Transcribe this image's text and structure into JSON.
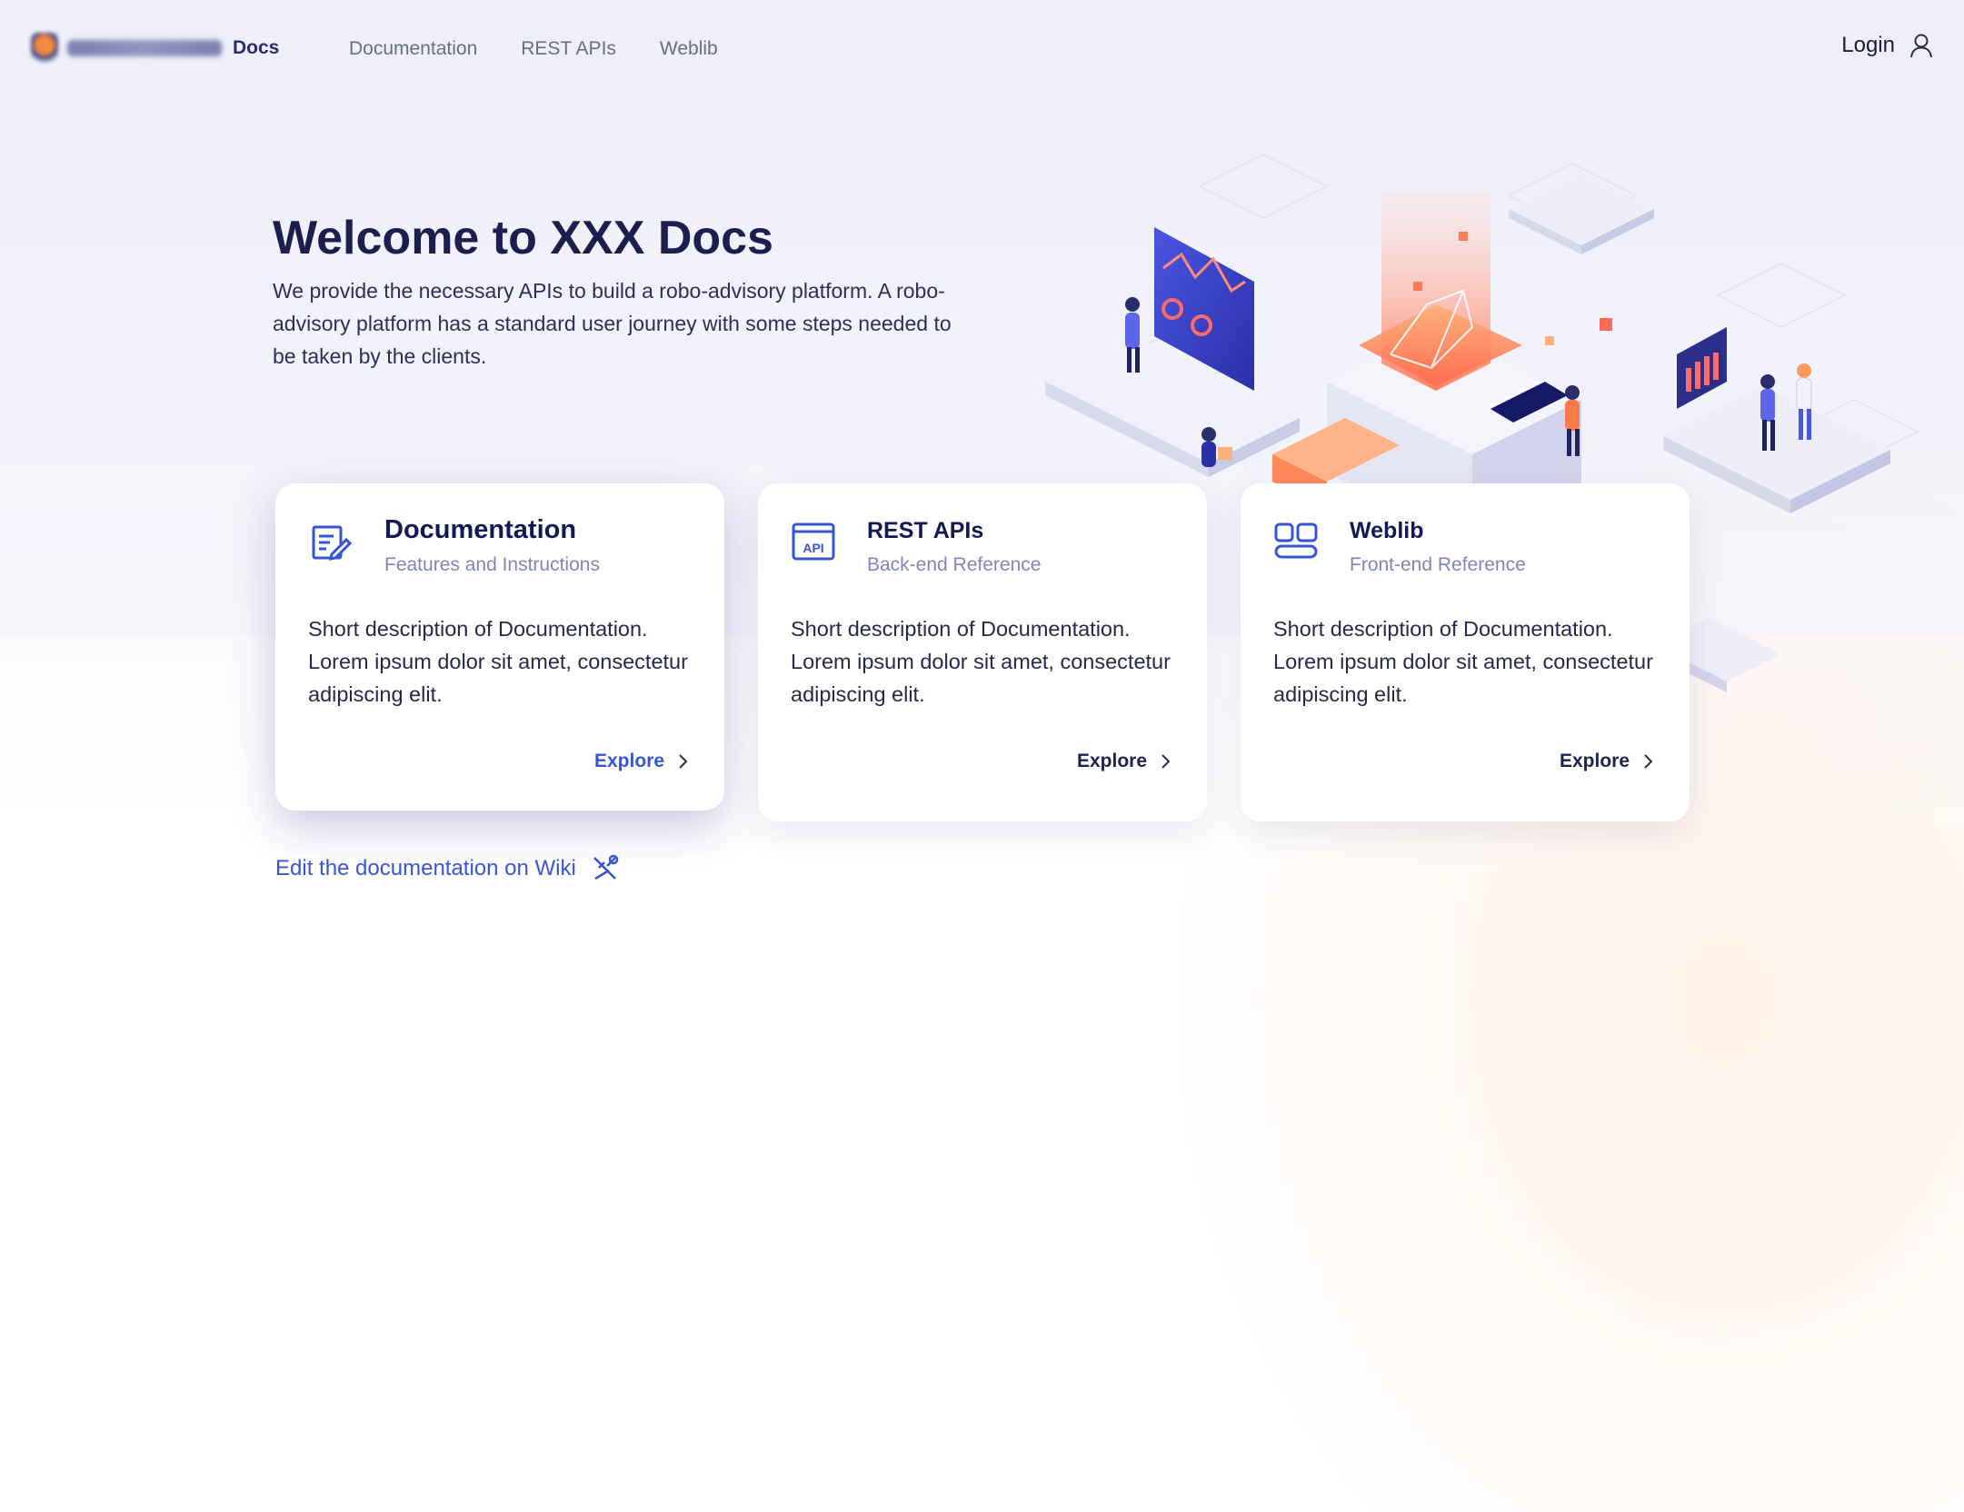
{
  "header": {
    "logo_text": "Docs",
    "nav": [
      {
        "label": "Documentation"
      },
      {
        "label": "REST APIs"
      },
      {
        "label": "Weblib"
      }
    ],
    "login_label": "Login"
  },
  "hero": {
    "title": "Welcome to XXX Docs",
    "description": "We provide the necessary APIs to build a robo-advisory platform. A robo-advisory platform has a standard user journey with some steps needed to be taken by the clients."
  },
  "cards": [
    {
      "icon": "document-edit-icon",
      "title": "Documentation",
      "subtitle": "Features and Instructions",
      "description": "Short description of Documentation. Lorem ipsum dolor sit amet, consectetur adipiscing elit.",
      "link_label": "Explore"
    },
    {
      "icon": "api-icon",
      "title": "REST APIs",
      "subtitle": "Back-end Reference",
      "description": "Short description of Documentation. Lorem ipsum dolor sit amet, consectetur adipiscing elit.",
      "link_label": "Explore"
    },
    {
      "icon": "widgets-icon",
      "title": "Weblib",
      "subtitle": "Front-end Reference",
      "description": "Short description of Documentation. Lorem ipsum dolor sit amet, consectetur adipiscing elit.",
      "link_label": "Explore"
    }
  ],
  "wiki": {
    "label": "Edit the documentation on Wiki",
    "icon": "tools-icon"
  },
  "colors": {
    "primary": "#3554d6",
    "heading": "#1a1f4e",
    "subtitle": "#7f86bf",
    "accent_orange": "#f47b4a"
  }
}
